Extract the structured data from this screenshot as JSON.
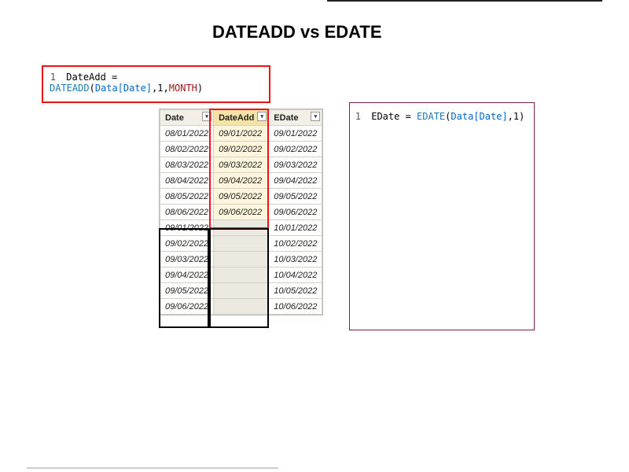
{
  "title": "DATEADD vs EDATE",
  "formula1": {
    "line_no": "1",
    "prefix": "DateAdd = ",
    "func": "DATEADD",
    "open": "(",
    "arg1": "Data[Date]",
    "c1": ",",
    "arg2": "1",
    "c2": ",",
    "arg3": "MONTH",
    "close": ")"
  },
  "formula2": {
    "line_no": "1",
    "prefix": "EDate = ",
    "func": "EDATE",
    "open": "(",
    "arg1": "Data[Date]",
    "c1": ",",
    "arg2": "1",
    "close": ")"
  },
  "cols": {
    "date": "Date",
    "dateadd": "DateAdd",
    "edate": "EDate"
  },
  "dropdown_glyph": "▾",
  "rows": [
    {
      "date": "08/01/2022",
      "dateadd": "09/01/2022",
      "edate": "09/01/2022"
    },
    {
      "date": "08/02/2022",
      "dateadd": "09/02/2022",
      "edate": "09/02/2022"
    },
    {
      "date": "08/03/2022",
      "dateadd": "09/03/2022",
      "edate": "09/03/2022"
    },
    {
      "date": "08/04/2022",
      "dateadd": "09/04/2022",
      "edate": "09/04/2022"
    },
    {
      "date": "08/05/2022",
      "dateadd": "09/05/2022",
      "edate": "09/05/2022"
    },
    {
      "date": "08/06/2022",
      "dateadd": "09/06/2022",
      "edate": "09/06/2022"
    },
    {
      "date": "09/01/2022",
      "dateadd": "",
      "edate": "10/01/2022"
    },
    {
      "date": "09/02/2022",
      "dateadd": "",
      "edate": "10/02/2022"
    },
    {
      "date": "09/03/2022",
      "dateadd": "",
      "edate": "10/03/2022"
    },
    {
      "date": "09/04/2022",
      "dateadd": "",
      "edate": "10/04/2022"
    },
    {
      "date": "09/05/2022",
      "dateadd": "",
      "edate": "10/05/2022"
    },
    {
      "date": "09/06/2022",
      "dateadd": "",
      "edate": "10/06/2022"
    }
  ]
}
